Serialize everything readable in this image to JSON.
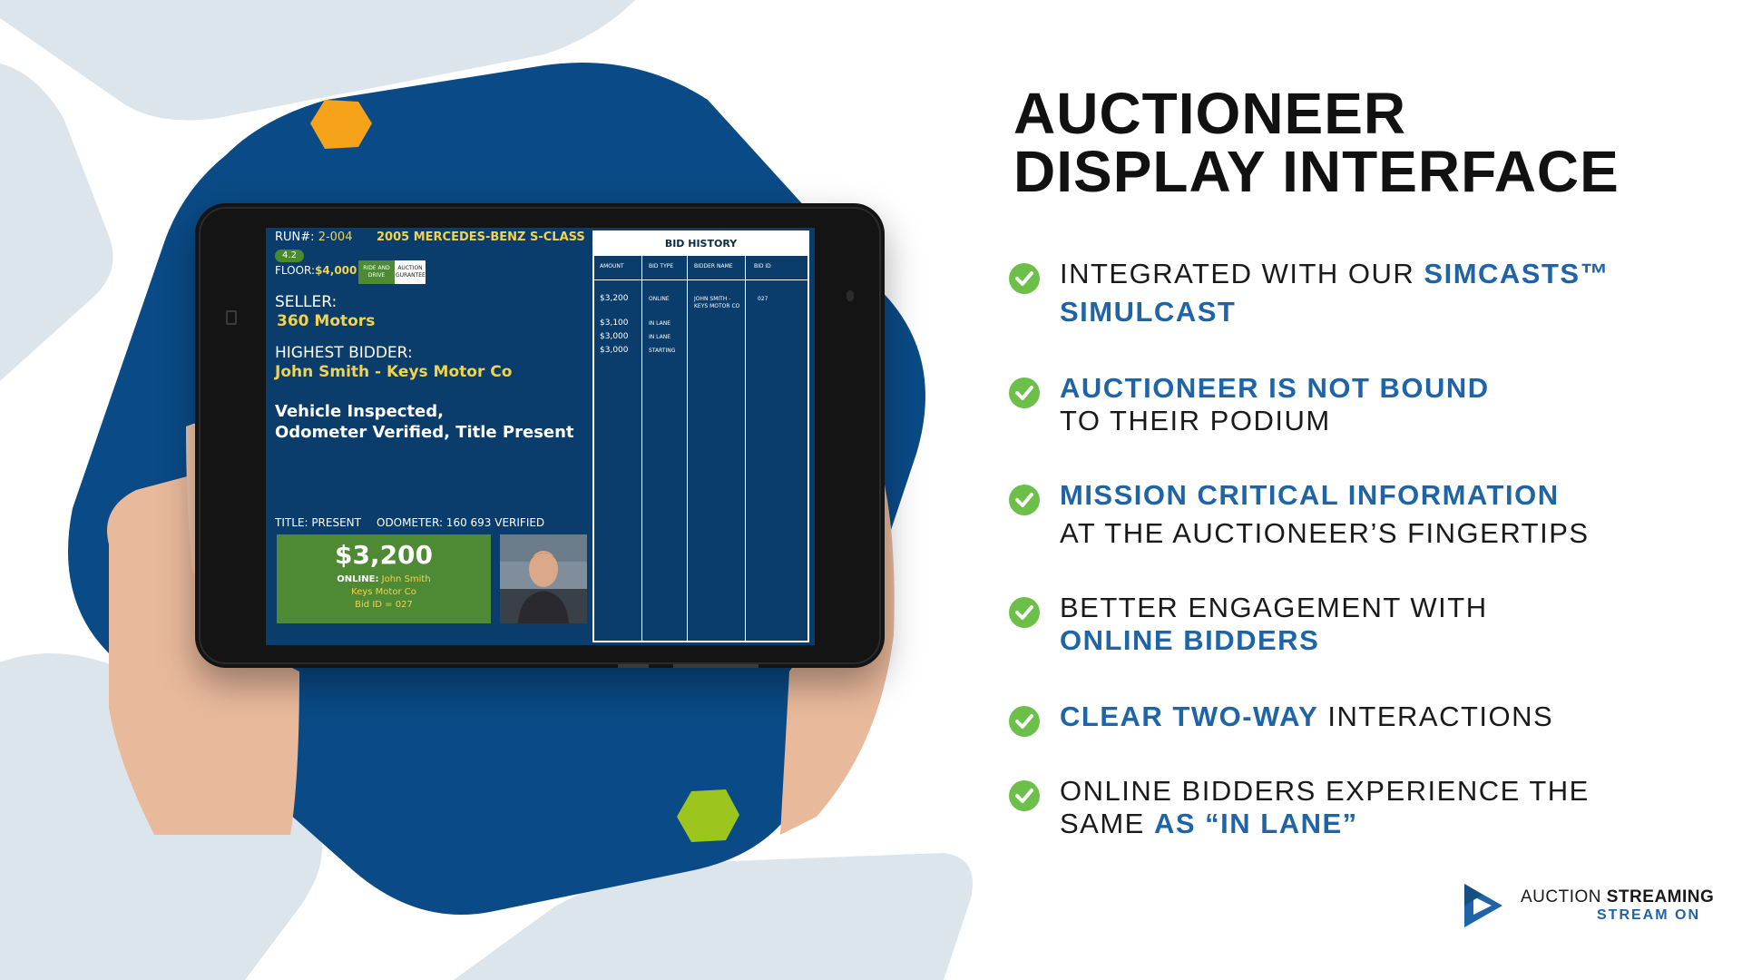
{
  "screen": {
    "run_label": "RUN#:",
    "run_number": "2-004",
    "vehicle": "2005 MERCEDES-BENZ S-CLASS",
    "grade": "4.2",
    "floor_label": "FLOOR:",
    "floor_value": "$4,000",
    "tag_ride_drive": "RIDE AND DRIVE",
    "tag_guarantee": "AUCTION GURANTEE",
    "seller_label": "SELLER:",
    "seller_name": "360 Motors",
    "highest_bidder_label": "HIGHEST BIDDER:",
    "highest_bidder_name": "John Smith - Keys Motor Co",
    "notes_line1": "Vehicle Inspected,",
    "notes_line2": "Odometer Verified, Title Present",
    "title_status": "TITLE: PRESENT",
    "odometer_status": "ODOMETER: 160 693 VERIFIED",
    "current_bid": "$3,200",
    "online_label": "ONLINE:",
    "online_name": "John Smith",
    "online_company": "Keys Motor Co",
    "bid_id": "Bid ID = 027"
  },
  "bid_history": {
    "title": "BID HISTORY",
    "headers": [
      "AMOUNT",
      "BID TYPE",
      "BIDDER NAME",
      "BID ID"
    ],
    "rows": [
      {
        "amount": "$3,200",
        "type": "ONLINE",
        "bidder_line1": "JOHN SMITH -",
        "bidder_line2": "KEYS MOTOR CO",
        "id": "027"
      },
      {
        "amount": "$3,100",
        "type": "IN LANE",
        "bidder_line1": "",
        "bidder_line2": "",
        "id": ""
      },
      {
        "amount": "$3,000",
        "type": "IN LANE",
        "bidder_line1": "",
        "bidder_line2": "",
        "id": ""
      },
      {
        "amount": "$3,000",
        "type": "STARTING",
        "bidder_line1": "",
        "bidder_line2": "",
        "id": ""
      }
    ]
  },
  "heading": {
    "line1": "AUCTIONEER",
    "line2": "DISPLAY INTERFACE"
  },
  "features": [
    {
      "l1a": "INTEGRATED WITH OUR ",
      "l1b": "SIMCASTS™",
      "l2a": "",
      "l2b": "SIMULCAST"
    },
    {
      "l1a": "",
      "l1b": "AUCTIONEER IS NOT BOUND",
      "l2a": "TO THEIR PODIUM",
      "l2b": ""
    },
    {
      "l1a": "",
      "l1b": "MISSION CRITICAL INFORMATION",
      "l2a": "AT THE AUCTIONEER’S FINGERTIPS",
      "l2b": ""
    },
    {
      "l1a": "BETTER ENGAGEMENT WITH",
      "l1b": "",
      "l2a": "",
      "l2b": "ONLINE BIDDERS"
    },
    {
      "l1a": "",
      "l1b": "CLEAR TWO-WAY",
      "l1c": " INTERACTIONS",
      "l2a": "",
      "l2b": ""
    },
    {
      "l1a": "ONLINE BIDDERS EXPERIENCE THE",
      "l1b": "",
      "l2a": "SAME ",
      "l2b": "AS “IN LANE”"
    }
  ],
  "brand": {
    "name_a": "AUCTION ",
    "name_b": "STREAMING",
    "tagline": "STREAM ON"
  },
  "colors": {
    "accent_blue": "#1f64a6",
    "dark_blue": "#0a4a86",
    "check_green": "#6cc04a",
    "price_green": "#4e8a34",
    "hex_orange": "#f7a31a",
    "hex_lime": "#9cc61e"
  }
}
